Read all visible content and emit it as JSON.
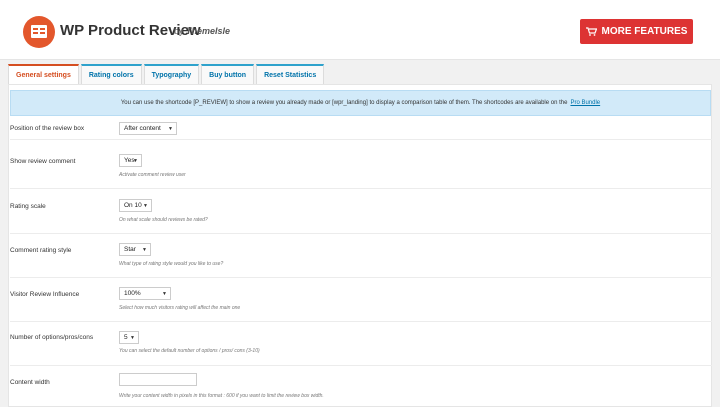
{
  "header": {
    "title": "WP Product Review",
    "by_prefix": "by",
    "by_author": "ThemeIsle",
    "more_features_label": "MORE FEATURES",
    "brand_color": "#e3572c",
    "button_color": "#dd3333"
  },
  "tabs": [
    {
      "label": "General settings",
      "active": true
    },
    {
      "label": "Rating colors"
    },
    {
      "label": "Typography"
    },
    {
      "label": "Buy button"
    },
    {
      "label": "Reset Statistics"
    }
  ],
  "notice": {
    "text": "You can use the shortcode [P_REVIEW] to show a review you already made or [wpr_landing] to display a comparison table of them. The shortcodes are available on the",
    "link": "Pro Bundle"
  },
  "settings": {
    "position": {
      "label": "Position of the review box",
      "value": "After content"
    },
    "show_comment": {
      "label": "Show review comment",
      "value": "Yes",
      "desc": "Activate comment review user"
    },
    "rating_scale": {
      "label": "Rating scale",
      "value": "On 10",
      "desc": "On what scale should reviews be rated?"
    },
    "comment_style": {
      "label": "Comment rating style",
      "value": "Star",
      "desc": "What type of rating style would you like to use?"
    },
    "visitor_influence": {
      "label": "Visitor Review Influence",
      "value": "100%",
      "desc": "Select how much visitors rating will affect the main one"
    },
    "num_options": {
      "label": "Number of options/pros/cons",
      "value": "5",
      "desc": "You can select the default number of options / pros/ cons (3-10)"
    },
    "content_width": {
      "label": "Content width",
      "value": "",
      "desc": "Write your content width in pixels in this format : 600 if you want to limit the review box width."
    }
  }
}
